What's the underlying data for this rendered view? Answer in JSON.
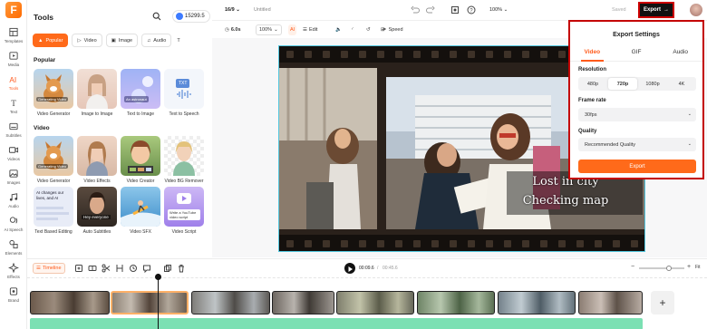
{
  "rail": {
    "items": [
      {
        "label": "Templates",
        "icon": "layout-icon"
      },
      {
        "label": "Media",
        "icon": "media-icon"
      },
      {
        "label": "Tools",
        "icon": "ai-tools-icon"
      },
      {
        "label": "Text",
        "icon": "text-icon"
      },
      {
        "label": "Subtitles",
        "icon": "subtitles-icon"
      },
      {
        "label": "Videos",
        "icon": "videos-icon"
      },
      {
        "label": "Images",
        "icon": "images-icon"
      },
      {
        "label": "Audio",
        "icon": "audio-icon"
      },
      {
        "label": "AI Speech",
        "icon": "ai-speech-icon"
      },
      {
        "label": "Elements",
        "icon": "elements-icon"
      },
      {
        "label": "Effects",
        "icon": "effects-icon"
      },
      {
        "label": "Brand",
        "icon": "brand-icon"
      }
    ]
  },
  "tools": {
    "title": "Tools",
    "credits": "15299.5",
    "tabs": [
      "Popular",
      "Video",
      "Image",
      "Audio",
      "T"
    ],
    "popular_heading": "Popular",
    "popular": [
      {
        "label": "Video Generator",
        "thumb_text": "Generating Video"
      },
      {
        "label": "Image to Image",
        "thumb_text": ""
      },
      {
        "label": "Text to Image",
        "thumb_text": "An astronaut"
      },
      {
        "label": "Text to Speech",
        "thumb_text": "TXT"
      }
    ],
    "video_heading": "Video",
    "video": [
      {
        "label": "Video Generator",
        "thumb_text": "Generating Video"
      },
      {
        "label": "Video Effects",
        "thumb_text": ""
      },
      {
        "label": "Video Creator",
        "thumb_text": ""
      },
      {
        "label": "Video BG Remover",
        "thumb_text": ""
      },
      {
        "label": "Text Based Editing",
        "thumb_text": "AI changes our lives, and AI"
      },
      {
        "label": "Auto Subtitles",
        "thumb_text": "Hey everyone"
      },
      {
        "label": "Video SFX",
        "thumb_text": ""
      },
      {
        "label": "Video Script",
        "thumb_text": "Write a YouTube video script"
      }
    ]
  },
  "topbar": {
    "aspect": "16/9",
    "doc_title": "Untitled",
    "zoom": "100%",
    "saved": "Saved",
    "export_label": "Export"
  },
  "toolrow": {
    "duration": "6.0s",
    "scale": "100%",
    "edit": "Edit",
    "speed": "Speed"
  },
  "video": {
    "caption_line1": "Lost in city",
    "caption_line2": "Checking map"
  },
  "export_panel": {
    "title": "Export Settings",
    "tabs": [
      "Video",
      "GIF",
      "Audio"
    ],
    "resolution_label": "Resolution",
    "resolutions": [
      "480p",
      "720p",
      "1080p",
      "4K"
    ],
    "selected_resolution": "720p",
    "framerate_label": "Frame rate",
    "framerate": "30fps",
    "quality_label": "Quality",
    "quality": "Recommended Quality",
    "button": "Export"
  },
  "timeline": {
    "label": "Timeline",
    "current_time": "00:09.6",
    "total_time": "00:45.6",
    "fit": "Fit",
    "add": "+"
  },
  "colors": {
    "accent": "#ff6a1a",
    "highlight_border": "#c40000",
    "audio_track": "#7be0b3"
  }
}
